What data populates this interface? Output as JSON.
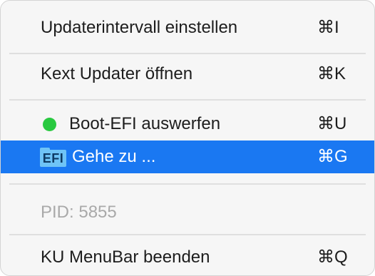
{
  "menu": {
    "items": [
      {
        "label": "Updaterintervall einstellen",
        "shortcut": "⌘I"
      },
      {
        "label": "Kext Updater öffnen",
        "shortcut": "⌘K"
      },
      {
        "label": "Boot-EFI auswerfen",
        "shortcut": "⌘U",
        "status_color": "#29c940"
      },
      {
        "label": "Gehe zu ...",
        "shortcut": "⌘G",
        "icon_text": "EFI",
        "icon": "efi-folder-icon"
      },
      {
        "label": "PID: 5855"
      },
      {
        "label": "KU MenuBar beenden",
        "shortcut": "⌘Q"
      }
    ],
    "selected_index": 3,
    "selection_color": "#1a78f2"
  }
}
